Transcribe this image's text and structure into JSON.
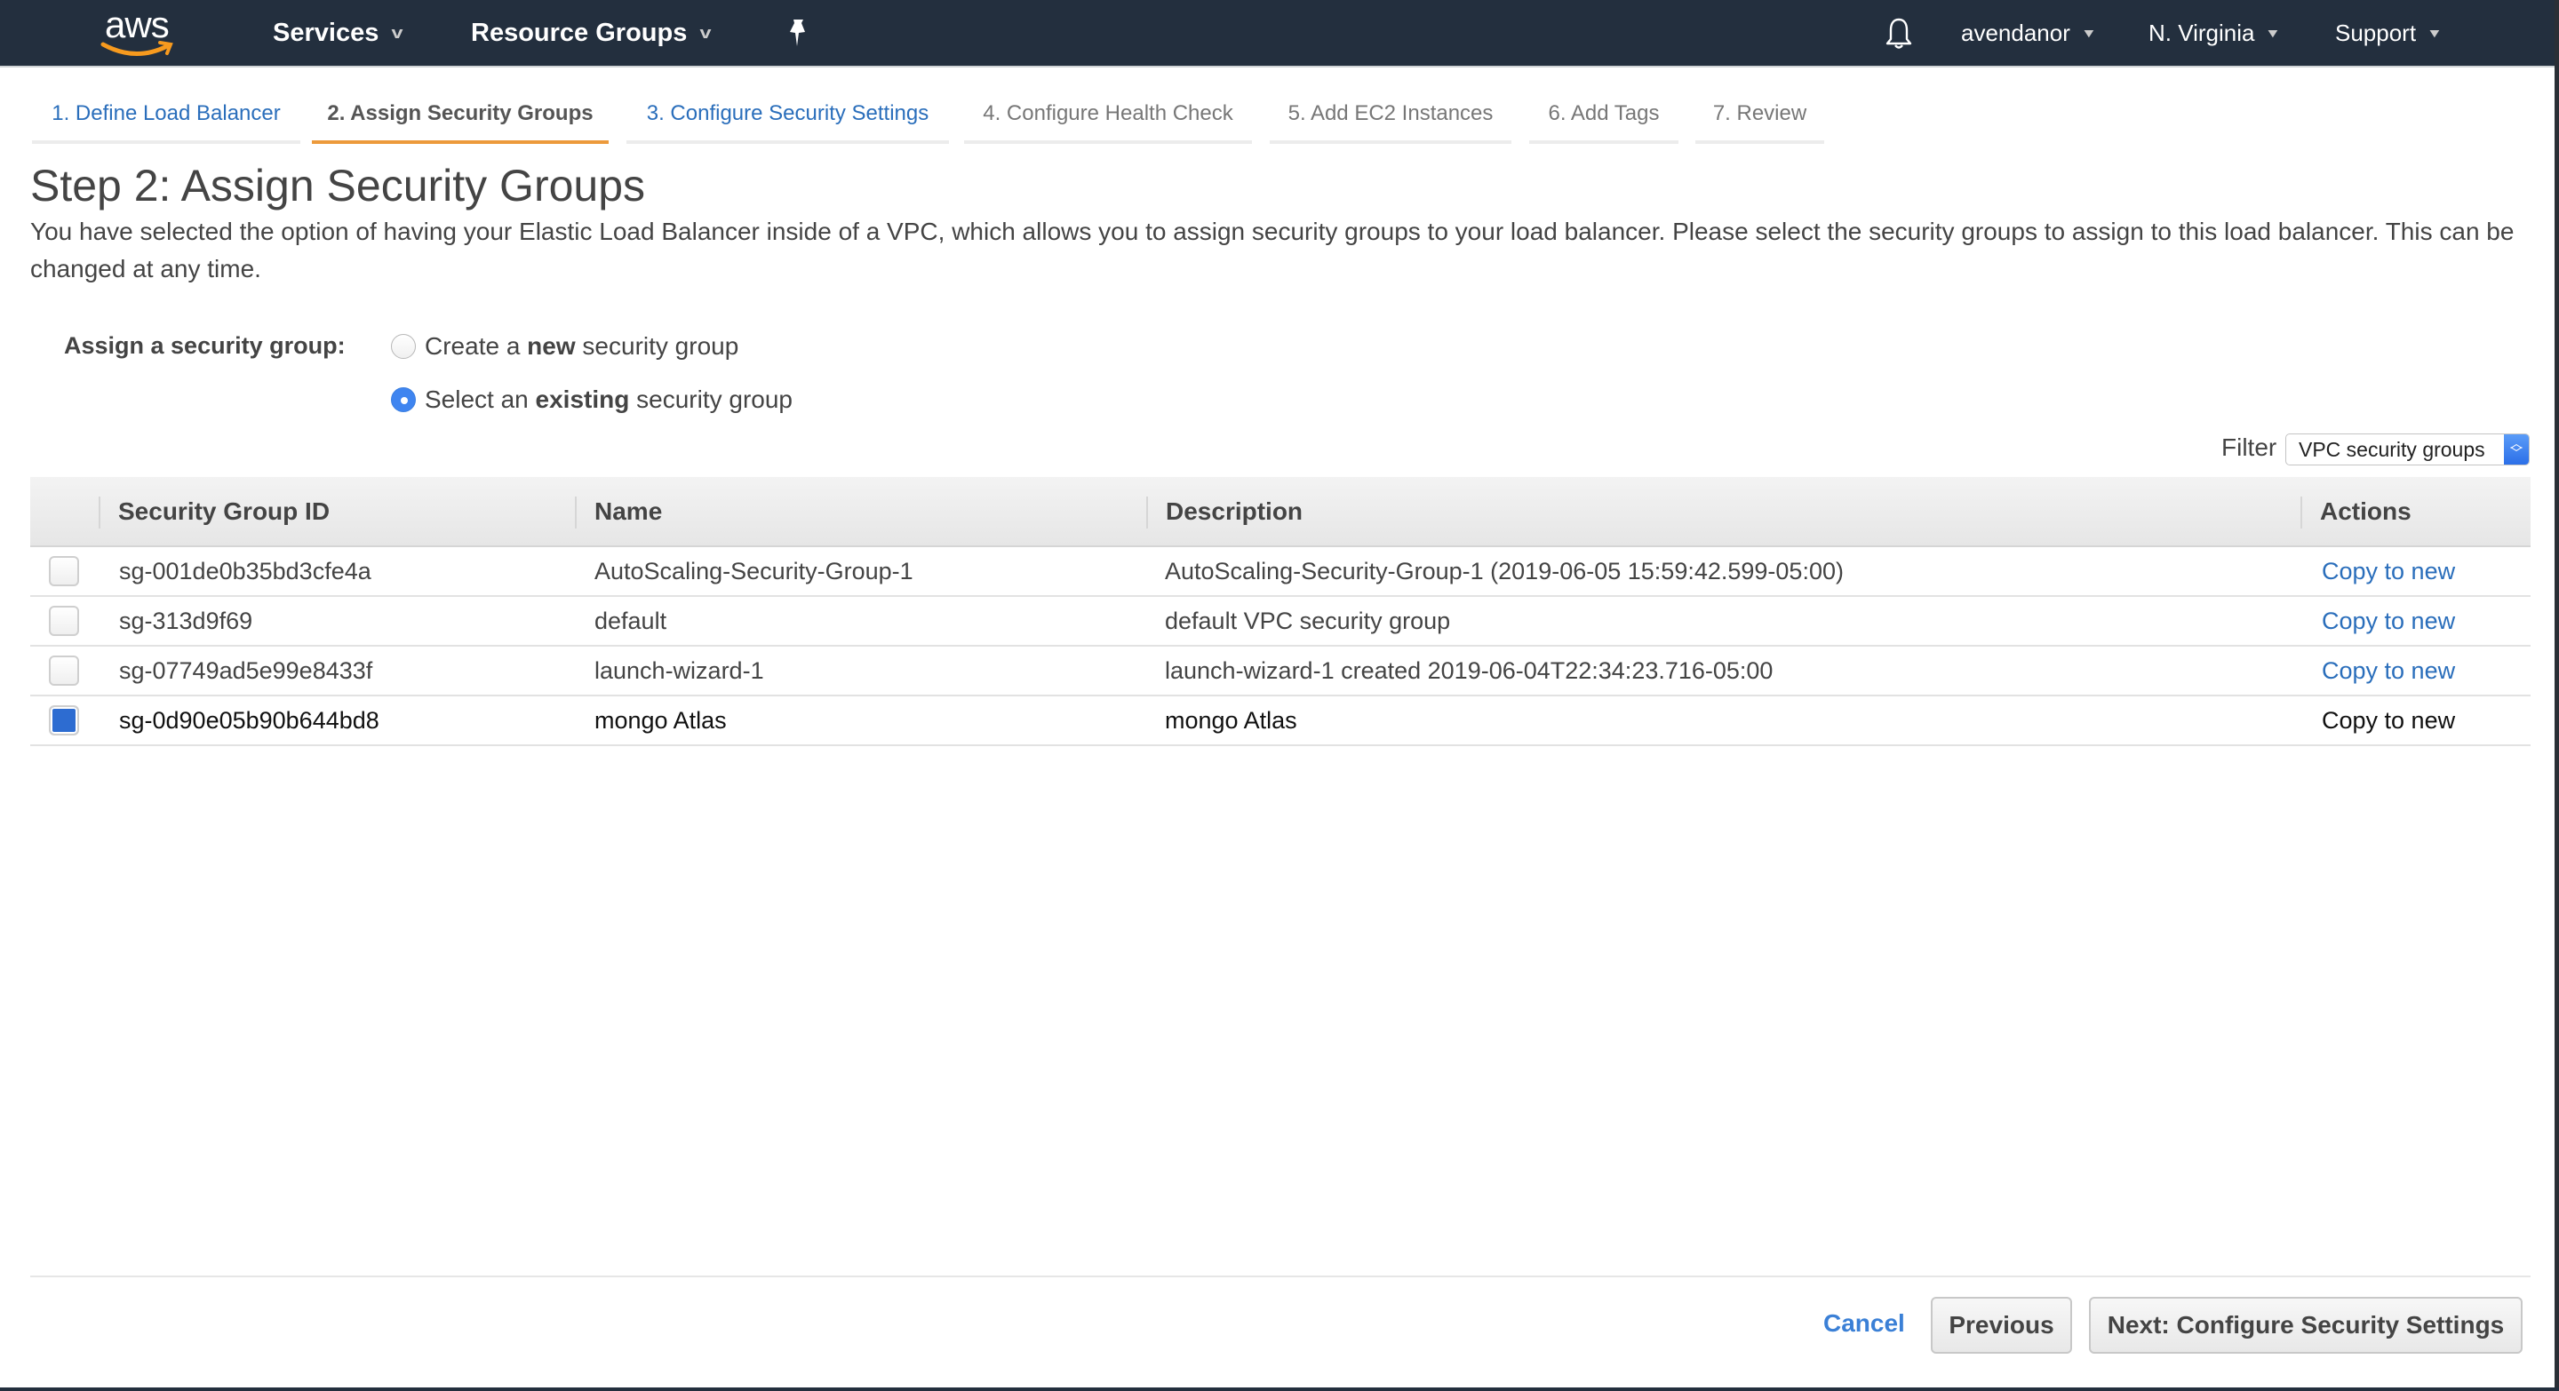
{
  "topnav": {
    "logo_text": "aws",
    "services": "Services",
    "resource_groups": "Resource Groups",
    "user": "avendanor",
    "region": "N. Virginia",
    "support": "Support"
  },
  "wizard": {
    "tabs": [
      {
        "label": "1. Define Load Balancer",
        "state": "done"
      },
      {
        "label": "2. Assign Security Groups",
        "state": "active"
      },
      {
        "label": "3. Configure Security Settings",
        "state": "done"
      },
      {
        "label": "4. Configure Health Check",
        "state": "pending"
      },
      {
        "label": "5. Add EC2 Instances",
        "state": "pending"
      },
      {
        "label": "6. Add Tags",
        "state": "pending"
      },
      {
        "label": "7. Review",
        "state": "pending"
      }
    ]
  },
  "page": {
    "title": "Step 2: Assign Security Groups",
    "description": "You have selected the option of having your Elastic Load Balancer inside of a VPC, which allows you to assign security groups to your load balancer. Please select the security groups to assign to this load balancer. This can be changed at any time."
  },
  "assign": {
    "label": "Assign a security group:",
    "options": [
      {
        "prefix": "Create a ",
        "bold": "new",
        "suffix": " security group",
        "checked": false
      },
      {
        "prefix": "Select an ",
        "bold": "existing",
        "suffix": " security group",
        "checked": true
      }
    ]
  },
  "filter": {
    "label": "Filter",
    "selected": "VPC security groups"
  },
  "table": {
    "columns": [
      "Security Group ID",
      "Name",
      "Description",
      "Actions"
    ],
    "rows": [
      {
        "id": "sg-001de0b35bd3cfe4a",
        "name": "AutoScaling-Security-Group-1",
        "description": "AutoScaling-Security-Group-1 (2019-06-05 15:59:42.599-05:00)",
        "action": "Copy to new",
        "checked": false
      },
      {
        "id": "sg-313d9f69",
        "name": "default",
        "description": "default VPC security group",
        "action": "Copy to new",
        "checked": false
      },
      {
        "id": "sg-07749ad5e99e8433f",
        "name": "launch-wizard-1",
        "description": "launch-wizard-1 created 2019-06-04T22:34:23.716-05:00",
        "action": "Copy to new",
        "checked": false
      },
      {
        "id": "sg-0d90e05b90b644bd8",
        "name": "mongo Atlas",
        "description": "mongo Atlas",
        "action": "Copy to new",
        "checked": true
      }
    ]
  },
  "footer": {
    "cancel": "Cancel",
    "previous": "Previous",
    "next": "Next: Configure Security Settings"
  },
  "colors": {
    "nav_bg": "#232f3e",
    "active_tab": "#ec9a3c",
    "link": "#2a6ebb",
    "checked": "#2d6cd1"
  }
}
